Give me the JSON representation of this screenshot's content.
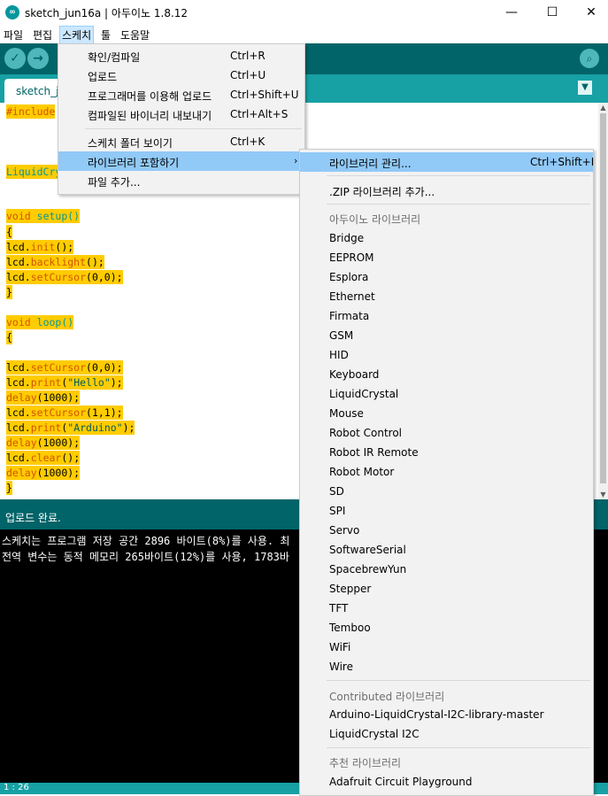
{
  "window": {
    "title": "sketch_jun16a | 아두이노 1.8.12",
    "minimize": "—",
    "maximize": "☐",
    "close": "✕"
  },
  "menubar": [
    "파일",
    "편집",
    "스케치",
    "툴",
    "도움말"
  ],
  "toolbar": {
    "verify_icon": "✓",
    "upload_icon": "→",
    "serial_icon": "⌕"
  },
  "tab": {
    "label": "sketch_j",
    "menu_icon": "▼"
  },
  "code": {
    "line1": "#include",
    "line2": "LiquidCry",
    "setup_kw": "void",
    "setup_fn": "setup()",
    "brace_open": "{",
    "brace_close": "}",
    "loop_kw": "void",
    "loop_fn": "loop()",
    "lcd": "lcd",
    "init": "init",
    "backlight": "backlight",
    "setCursor": "setCursor",
    "print": "print",
    "clear": "clear",
    "delay": "delay",
    "args_00": "(0,0);",
    "args_11": "(1,1);",
    "args_empty": "();",
    "args_delay": "(1000);",
    "str_hello": "\"Hello\"",
    "str_arduino": "\"Arduino\"",
    "close_paren": ");",
    "open_paren": "("
  },
  "status": {
    "message": "업로드 완료."
  },
  "console": {
    "line1": "스케치는 프로그램 저장 공간 2896 바이트(8%)를 사용. 최",
    "line2": "전역 변수는 동적 메모리 265바이트(12%)를 사용, 1783바"
  },
  "bottom": {
    "line_info": "1 : 26"
  },
  "sketch_menu": {
    "items": [
      {
        "label": "확인/컴파일",
        "shortcut": "Ctrl+R"
      },
      {
        "label": "업로드",
        "shortcut": "Ctrl+U"
      },
      {
        "label": "프로그래머를 이용해 업로드",
        "shortcut": "Ctrl+Shift+U"
      },
      {
        "label": "컴파일된 바이너리 내보내기",
        "shortcut": "Ctrl+Alt+S"
      },
      {
        "label": "스케치 폴더 보이기",
        "shortcut": "Ctrl+K"
      },
      {
        "label": "라이브러리 포함하기",
        "shortcut": "",
        "arrow": "›"
      },
      {
        "label": "파일 추가...",
        "shortcut": ""
      }
    ]
  },
  "library_menu": {
    "manage": {
      "label": "라이브러리 관리...",
      "shortcut": "Ctrl+Shift+I"
    },
    "add_zip": ".ZIP 라이브러리 추가...",
    "arduino_header": "아두이노 라이브러리",
    "arduino_libs": [
      "Bridge",
      "EEPROM",
      "Esplora",
      "Ethernet",
      "Firmata",
      "GSM",
      "HID",
      "Keyboard",
      "LiquidCrystal",
      "Mouse",
      "Robot Control",
      "Robot IR Remote",
      "Robot Motor",
      "SD",
      "SPI",
      "Servo",
      "SoftwareSerial",
      "SpacebrewYun",
      "Stepper",
      "TFT",
      "Temboo",
      "WiFi",
      "Wire"
    ],
    "contributed_header": "Contributed 라이브러리",
    "contributed_libs": [
      "Arduino-LiquidCrystal-I2C-library-master",
      "LiquidCrystal I2C"
    ],
    "recommended_header": "추천 라이브러리",
    "recommended_libs": [
      "Adafruit Circuit Playground"
    ]
  },
  "colors": {
    "toolbar": "#006468",
    "tabbar": "#17a1a5",
    "code_highlight": "#ffcc00",
    "menu_highlight": "#91c9f7"
  }
}
